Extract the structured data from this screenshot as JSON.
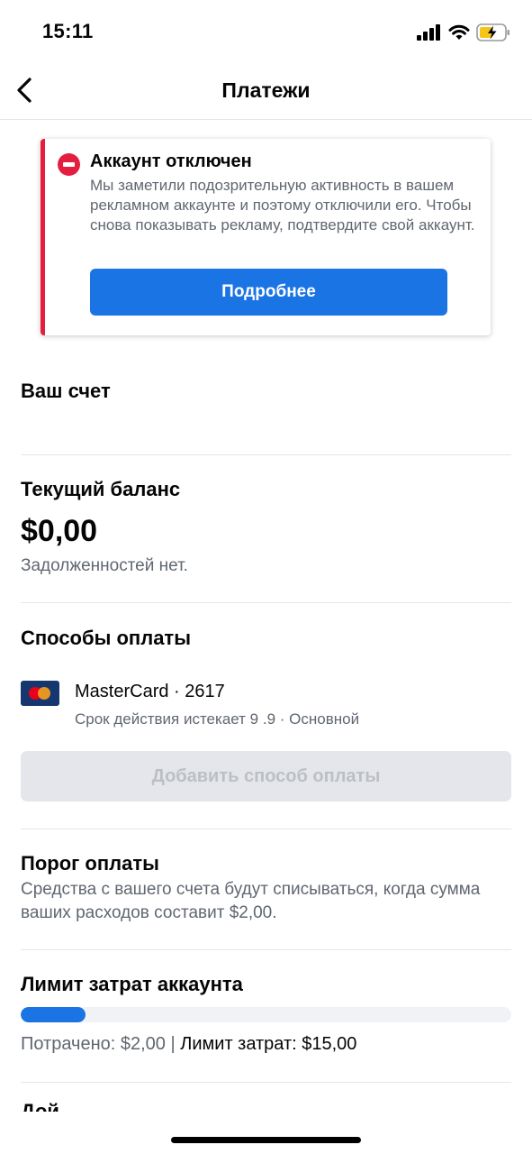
{
  "status_bar": {
    "time": "15:11"
  },
  "nav": {
    "title": "Платежи"
  },
  "alert": {
    "title": "Аккаунт отключен",
    "body": "Мы заметили подозрительную активность в вашем рекламном аккаунте и поэтому отключили его. Чтобы снова показывать рекламу, подтвердите свой аккаунт.",
    "button_label": "Подробнее"
  },
  "account": {
    "title": "Ваш счет",
    "name": ""
  },
  "balance": {
    "title": "Текущий баланс",
    "amount": "$0,00",
    "note": "Задолженностей нет."
  },
  "payment_methods": {
    "title": "Способы оплаты",
    "card": {
      "name": "MasterCard · 2617",
      "details": "Срок действия истекает 9 ⁠⁠.⁠9 · Основной"
    },
    "add_label": "Добавить способ оплаты"
  },
  "threshold": {
    "title": "Порог оплаты",
    "description": "Средства с вашего счета будут списываться, когда сумма ваших расходов составит $2,00."
  },
  "spending_limit": {
    "title": "Лимит затрат аккаунта",
    "spent_text": "Потрачено: $2,00 |",
    "limit_text": "Лимит затрат: $15,00",
    "progress_fraction": 0.133
  },
  "next_section_partial": {
    "title": "Дой"
  },
  "colors": {
    "accent": "#1b74e4",
    "danger": "#e41e3f",
    "secondary_text": "#606770",
    "divider": "#e4e6eb"
  },
  "icons": [
    "cellular-signal-icon",
    "wifi-icon",
    "battery-charging-icon",
    "back-chevron-icon",
    "blocked-icon",
    "mastercard-icon"
  ]
}
